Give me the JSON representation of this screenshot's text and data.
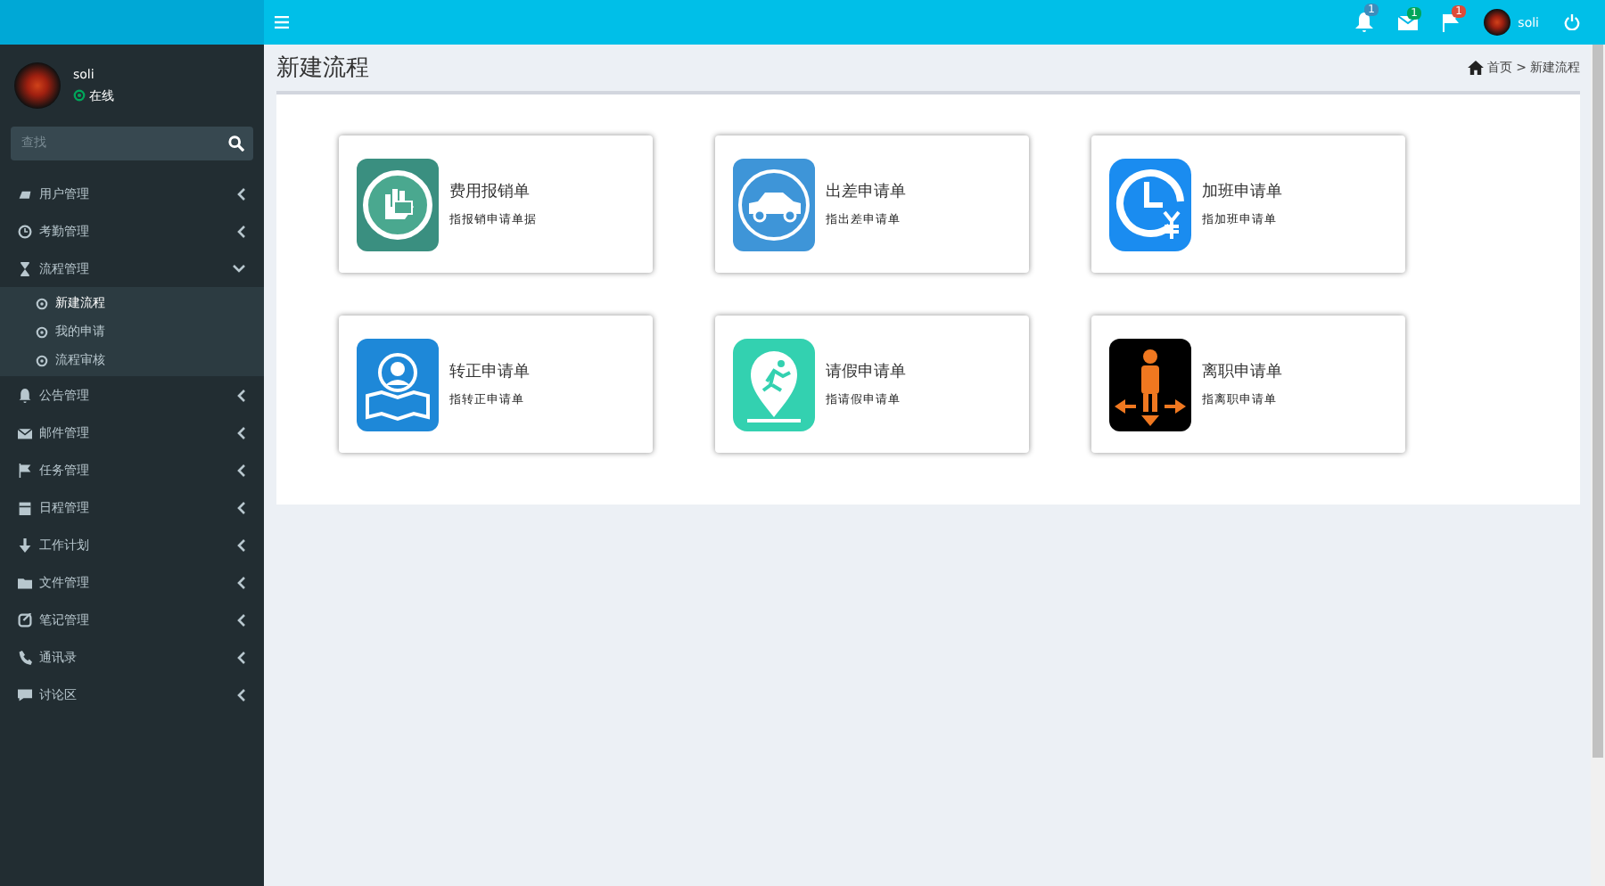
{
  "topbar": {
    "notifications": [
      {
        "count": "1",
        "color": "#3c8dbc"
      },
      {
        "count": "1",
        "color": "#00a65a"
      },
      {
        "count": "1",
        "color": "#dd4b39"
      }
    ],
    "user": "soli"
  },
  "sidebar": {
    "user": {
      "name": "soli",
      "status": "在线"
    },
    "search": {
      "placeholder": "查找"
    },
    "items": [
      {
        "label": "用户管理",
        "expanded": false
      },
      {
        "label": "考勤管理",
        "expanded": false
      },
      {
        "label": "流程管理",
        "expanded": true,
        "children": [
          {
            "label": "新建流程",
            "selected": true
          },
          {
            "label": "我的申请",
            "selected": false
          },
          {
            "label": "流程审核",
            "selected": false
          }
        ]
      },
      {
        "label": "公告管理",
        "expanded": false
      },
      {
        "label": "邮件管理",
        "expanded": false
      },
      {
        "label": "任务管理",
        "expanded": false
      },
      {
        "label": "日程管理",
        "expanded": false
      },
      {
        "label": "工作计划",
        "expanded": false
      },
      {
        "label": "文件管理",
        "expanded": false
      },
      {
        "label": "笔记管理",
        "expanded": false
      },
      {
        "label": "通讯录",
        "expanded": false
      },
      {
        "label": "讨论区",
        "expanded": false
      }
    ]
  },
  "page": {
    "title": "新建流程",
    "breadcrumb": [
      "首页",
      "新建流程"
    ],
    "separator": ">"
  },
  "cards": [
    {
      "title": "费用报销单",
      "description": "指报销申请单据"
    },
    {
      "title": "出差申请单",
      "description": "指出差申请单"
    },
    {
      "title": "加班申请单",
      "description": "指加班申请单"
    },
    {
      "title": "转正申请单",
      "description": "指转正申请单"
    },
    {
      "title": "请假申请单",
      "description": "指请假申请单"
    },
    {
      "title": "离职申请单",
      "description": "指离职申请单"
    }
  ]
}
